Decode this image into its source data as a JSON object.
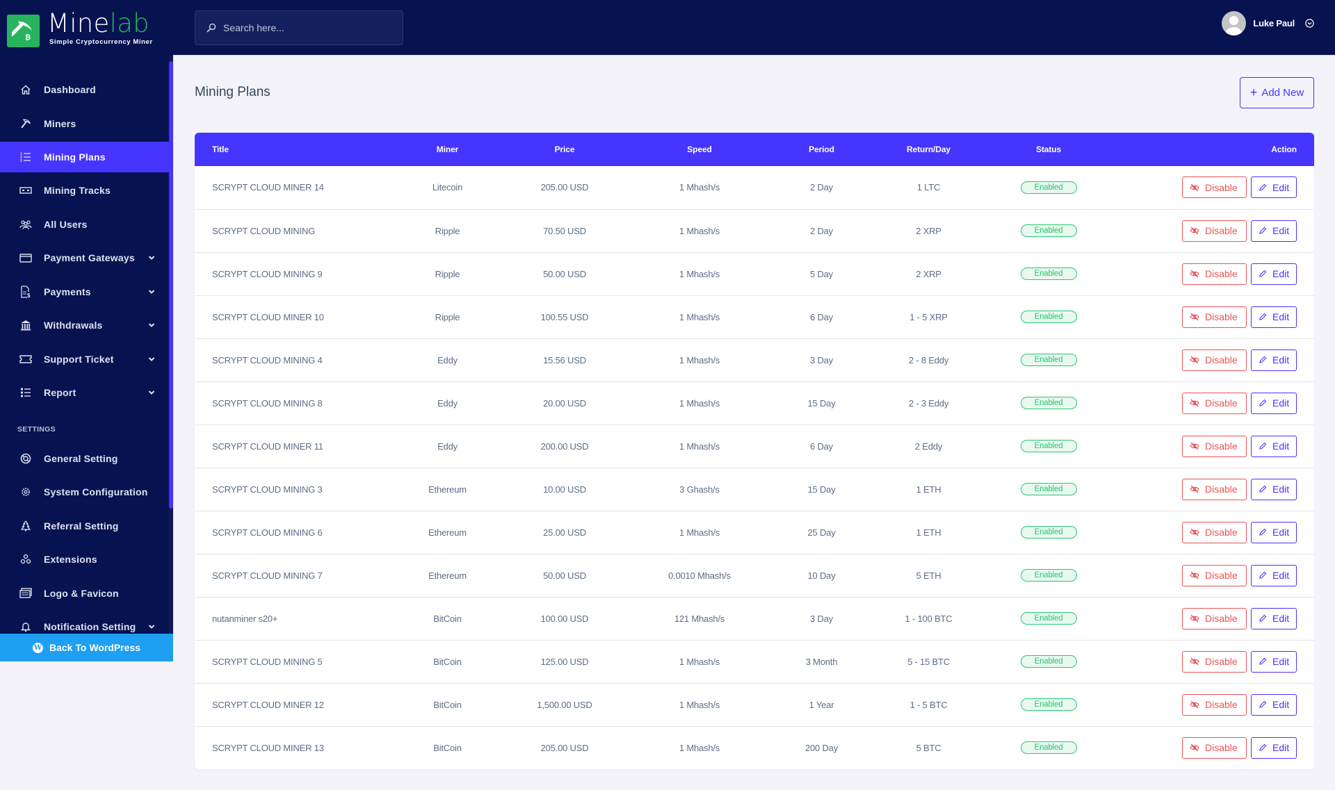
{
  "brand": {
    "name_part1": "Mine",
    "name_part2": "lab",
    "tagline": "Simple Cryptocurrency Miner",
    "accent_color": "#28b35f"
  },
  "sidebar": {
    "items": [
      {
        "label": "Dashboard",
        "icon": "home-icon",
        "active": false,
        "has_caret": false
      },
      {
        "label": "Miners",
        "icon": "pickaxe-icon",
        "active": false,
        "has_caret": false
      },
      {
        "label": "Mining Plans",
        "icon": "list-ol-icon",
        "active": true,
        "has_caret": false
      },
      {
        "label": "Mining Tracks",
        "icon": "money-bill-icon",
        "active": false,
        "has_caret": false
      },
      {
        "label": "All Users",
        "icon": "users-icon",
        "active": false,
        "has_caret": false
      },
      {
        "label": "Payment Gateways",
        "icon": "credit-card-icon",
        "active": false,
        "has_caret": true
      },
      {
        "label": "Payments",
        "icon": "file-invoice-dollar-icon",
        "active": false,
        "has_caret": true
      },
      {
        "label": "Withdrawals",
        "icon": "bank-icon",
        "active": false,
        "has_caret": true
      },
      {
        "label": "Support Ticket",
        "icon": "ticket-icon",
        "active": false,
        "has_caret": true
      },
      {
        "label": "Report",
        "icon": "list-icon",
        "active": false,
        "has_caret": true
      }
    ],
    "settings_heading": "SETTINGS",
    "settings_items": [
      {
        "label": "General Setting",
        "icon": "life-ring-icon",
        "has_caret": false
      },
      {
        "label": "System Configuration",
        "icon": "gear-icon",
        "has_caret": false
      },
      {
        "label": "Referral Setting",
        "icon": "tree-icon",
        "has_caret": false
      },
      {
        "label": "Extensions",
        "icon": "cubes-icon",
        "has_caret": false
      },
      {
        "label": "Logo & Favicon",
        "icon": "images-icon",
        "has_caret": false
      },
      {
        "label": "Notification Setting",
        "icon": "bell-icon",
        "has_caret": true
      }
    ],
    "back_label": "Back To WordPress",
    "active_color": "#4634ff",
    "background_color": "#071251"
  },
  "header": {
    "search_placeholder": "Search here...",
    "user_name": "Luke Paul"
  },
  "page": {
    "title": "Mining Plans",
    "add_new_label": "Add New"
  },
  "table": {
    "header_color": "#4634ff",
    "columns": [
      "Title",
      "Miner",
      "Price",
      "Speed",
      "Period",
      "Return/Day",
      "Status",
      "Action"
    ],
    "rows": [
      {
        "title": "SCRYPT CLOUD MINER 14",
        "miner": "Litecoin",
        "price": "205.00 USD",
        "speed": "1 Mhash/s",
        "period": "2 Day",
        "return": "1 LTC",
        "status": "Enabled"
      },
      {
        "title": "SCRYPT CLOUD MINING",
        "miner": "Ripple",
        "price": "70.50 USD",
        "speed": "1 Mhash/s",
        "period": "2 Day",
        "return": "2 XRP",
        "status": "Enabled"
      },
      {
        "title": "SCRYPT CLOUD MINING 9",
        "miner": "Ripple",
        "price": "50.00 USD",
        "speed": "1 Mhash/s",
        "period": "5 Day",
        "return": "2 XRP",
        "status": "Enabled"
      },
      {
        "title": "SCRYPT CLOUD MINER 10",
        "miner": "Ripple",
        "price": "100.55 USD",
        "speed": "1 Mhash/s",
        "period": "6 Day",
        "return": "1 - 5 XRP",
        "status": "Enabled"
      },
      {
        "title": "SCRYPT CLOUD MINING 4",
        "miner": "Eddy",
        "price": "15.56 USD",
        "speed": "1 Mhash/s",
        "period": "3 Day",
        "return": "2 - 8 Eddy",
        "status": "Enabled"
      },
      {
        "title": "SCRYPT CLOUD MINING 8",
        "miner": "Eddy",
        "price": "20.00 USD",
        "speed": "1 Mhash/s",
        "period": "15 Day",
        "return": "2 - 3 Eddy",
        "status": "Enabled"
      },
      {
        "title": "SCRYPT CLOUD MINER 11",
        "miner": "Eddy",
        "price": "200.00 USD",
        "speed": "1 Mhash/s",
        "period": "6 Day",
        "return": "2 Eddy",
        "status": "Enabled"
      },
      {
        "title": "SCRYPT CLOUD MINING 3",
        "miner": "Ethereum",
        "price": "10.00 USD",
        "speed": "3 Ghash/s",
        "period": "15 Day",
        "return": "1 ETH",
        "status": "Enabled"
      },
      {
        "title": "SCRYPT CLOUD MINING 6",
        "miner": "Ethereum",
        "price": "25.00 USD",
        "speed": "1 Mhash/s",
        "period": "25 Day",
        "return": "1 ETH",
        "status": "Enabled"
      },
      {
        "title": "SCRYPT CLOUD MINING 7",
        "miner": "Ethereum",
        "price": "50.00 USD",
        "speed": "0.0010 Mhash/s",
        "period": "10 Day",
        "return": "5 ETH",
        "status": "Enabled"
      },
      {
        "title": "nutanminer s20+",
        "miner": "BitCoin",
        "price": "100.00 USD",
        "speed": "121 Mhash/s",
        "period": "3 Day",
        "return": "1 - 100 BTC",
        "status": "Enabled"
      },
      {
        "title": "SCRYPT CLOUD MINING 5",
        "miner": "BitCoin",
        "price": "125.00 USD",
        "speed": "1 Mhash/s",
        "period": "3 Month",
        "return": "5 - 15 BTC",
        "status": "Enabled"
      },
      {
        "title": "SCRYPT CLOUD MINER 12",
        "miner": "BitCoin",
        "price": "1,500.00 USD",
        "speed": "1 Mhash/s",
        "period": "1 Year",
        "return": "1 - 5 BTC",
        "status": "Enabled"
      },
      {
        "title": "SCRYPT CLOUD MINER 13",
        "miner": "BitCoin",
        "price": "205.00 USD",
        "speed": "1 Mhash/s",
        "period": "200 Day",
        "return": "5 BTC",
        "status": "Enabled"
      }
    ],
    "disable_label": "Disable",
    "edit_label": "Edit",
    "status_color": "#28c76f",
    "disable_color": "#ea5455"
  }
}
